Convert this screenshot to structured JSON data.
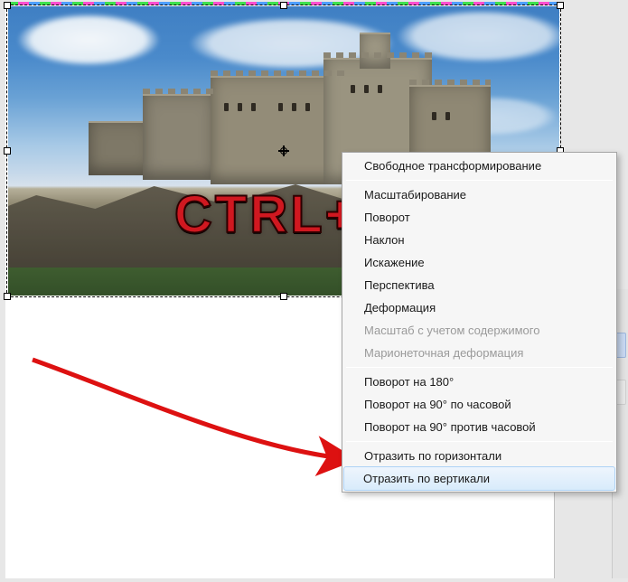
{
  "shortcut_overlay": "CTRL+T",
  "context_menu": {
    "groups": [
      {
        "items": [
          {
            "label": "Свободное трансформирование",
            "enabled": true,
            "key": "free-transform"
          }
        ]
      },
      {
        "items": [
          {
            "label": "Масштабирование",
            "enabled": true,
            "key": "scale"
          },
          {
            "label": "Поворот",
            "enabled": true,
            "key": "rotate"
          },
          {
            "label": "Наклон",
            "enabled": true,
            "key": "skew"
          },
          {
            "label": "Искажение",
            "enabled": true,
            "key": "distort"
          },
          {
            "label": "Перспектива",
            "enabled": true,
            "key": "perspective"
          },
          {
            "label": "Деформация",
            "enabled": true,
            "key": "warp"
          },
          {
            "label": "Масштаб с учетом содержимого",
            "enabled": false,
            "key": "content-aware-scale"
          },
          {
            "label": "Марионеточная деформация",
            "enabled": false,
            "key": "puppet-warp"
          }
        ]
      },
      {
        "items": [
          {
            "label": "Поворот на 180°",
            "enabled": true,
            "key": "rotate-180"
          },
          {
            "label": "Поворот на 90° по часовой",
            "enabled": true,
            "key": "rotate-90-cw"
          },
          {
            "label": "Поворот на 90° против часовой",
            "enabled": true,
            "key": "rotate-90-ccw"
          }
        ]
      },
      {
        "items": [
          {
            "label": "Отразить по горизонтали",
            "enabled": true,
            "key": "flip-horizontal"
          },
          {
            "label": "Отразить по вертикали",
            "enabled": true,
            "key": "flip-vertical",
            "highlight": true
          }
        ]
      }
    ]
  }
}
